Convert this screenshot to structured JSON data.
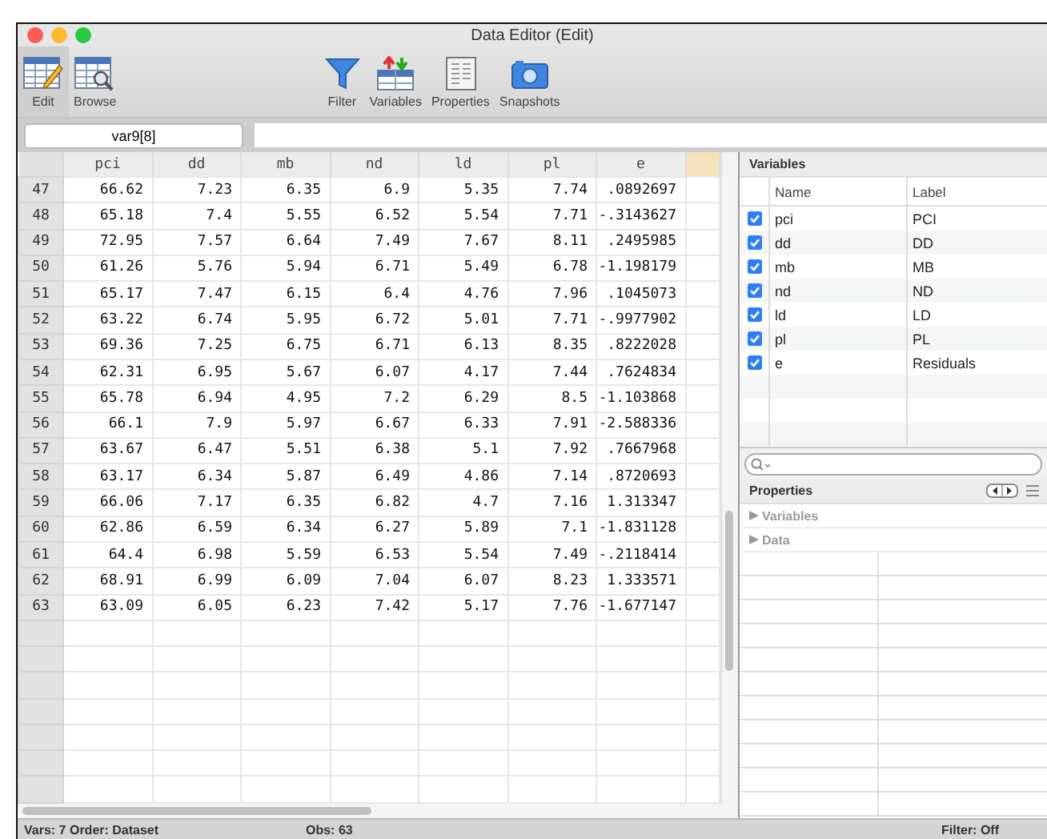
{
  "window": {
    "title": "Data Editor (Edit)"
  },
  "toolbar": {
    "modes": [
      {
        "label": "Edit",
        "kind": "edit",
        "selected": true
      },
      {
        "label": "Browse",
        "kind": "browse",
        "selected": false
      }
    ],
    "tools": [
      {
        "label": "Filter",
        "kind": "filter"
      },
      {
        "label": "Variables",
        "kind": "variables"
      },
      {
        "label": "Properties",
        "kind": "properties"
      },
      {
        "label": "Snapshots",
        "kind": "snapshots"
      }
    ]
  },
  "cell_reference": "var9[8]",
  "table": {
    "columns": [
      "pci",
      "dd",
      "mb",
      "nd",
      "ld",
      "pl",
      "e"
    ],
    "rows": [
      {
        "number": "47",
        "cells": [
          "66.62",
          "7.23",
          "6.35",
          "6.9",
          "5.35",
          "7.74",
          ".0892697"
        ]
      },
      {
        "number": "48",
        "cells": [
          "65.18",
          "7.4",
          "5.55",
          "6.52",
          "5.54",
          "7.71",
          "-.3143627"
        ]
      },
      {
        "number": "49",
        "cells": [
          "72.95",
          "7.57",
          "6.64",
          "7.49",
          "7.67",
          "8.11",
          ".2495985"
        ]
      },
      {
        "number": "50",
        "cells": [
          "61.26",
          "5.76",
          "5.94",
          "6.71",
          "5.49",
          "6.78",
          "-1.198179"
        ]
      },
      {
        "number": "51",
        "cells": [
          "65.17",
          "7.47",
          "6.15",
          "6.4",
          "4.76",
          "7.96",
          ".1045073"
        ]
      },
      {
        "number": "52",
        "cells": [
          "63.22",
          "6.74",
          "5.95",
          "6.72",
          "5.01",
          "7.71",
          "-.9977902"
        ]
      },
      {
        "number": "53",
        "cells": [
          "69.36",
          "7.25",
          "6.75",
          "6.71",
          "6.13",
          "8.35",
          ".8222028"
        ]
      },
      {
        "number": "54",
        "cells": [
          "62.31",
          "6.95",
          "5.67",
          "6.07",
          "4.17",
          "7.44",
          ".7624834"
        ]
      },
      {
        "number": "55",
        "cells": [
          "65.78",
          "6.94",
          "4.95",
          "7.2",
          "6.29",
          "8.5",
          "-1.103868"
        ]
      },
      {
        "number": "56",
        "cells": [
          "66.1",
          "7.9",
          "5.97",
          "6.67",
          "6.33",
          "7.91",
          "-2.588336"
        ]
      },
      {
        "number": "57",
        "cells": [
          "63.67",
          "6.47",
          "5.51",
          "6.38",
          "5.1",
          "7.92",
          ".7667968"
        ]
      },
      {
        "number": "58",
        "cells": [
          "63.17",
          "6.34",
          "5.87",
          "6.49",
          "4.86",
          "7.14",
          ".8720693"
        ]
      },
      {
        "number": "59",
        "cells": [
          "66.06",
          "7.17",
          "6.35",
          "6.82",
          "4.7",
          "7.16",
          "1.313347"
        ]
      },
      {
        "number": "60",
        "cells": [
          "62.86",
          "6.59",
          "6.34",
          "6.27",
          "5.89",
          "7.1",
          "-1.831128"
        ]
      },
      {
        "number": "61",
        "cells": [
          "64.4",
          "6.98",
          "5.59",
          "6.53",
          "5.54",
          "7.49",
          "-.2118414"
        ]
      },
      {
        "number": "62",
        "cells": [
          "68.91",
          "6.99",
          "6.09",
          "7.04",
          "6.07",
          "8.23",
          "1.333571"
        ]
      },
      {
        "number": "63",
        "cells": [
          "63.09",
          "6.05",
          "6.23",
          "7.42",
          "5.17",
          "7.76",
          "-1.677147"
        ]
      }
    ]
  },
  "variables_panel": {
    "title": "Variables",
    "columns": [
      "Name",
      "Label"
    ],
    "rows": [
      {
        "name": "pci",
        "label": "PCI",
        "checked": true
      },
      {
        "name": "dd",
        "label": "DD",
        "checked": true
      },
      {
        "name": "mb",
        "label": "MB",
        "checked": true
      },
      {
        "name": "nd",
        "label": "ND",
        "checked": true
      },
      {
        "name": "ld",
        "label": "LD",
        "checked": true
      },
      {
        "name": "pl",
        "label": "PL",
        "checked": true
      },
      {
        "name": "e",
        "label": "Residuals",
        "checked": true
      }
    ]
  },
  "properties_panel": {
    "title": "Properties",
    "sections": [
      {
        "label": "Variables",
        "expanded": false
      },
      {
        "label": "Data",
        "expanded": false
      }
    ]
  },
  "status_bar": [
    "Vars: 7  Order: Dataset",
    "Obs: 63",
    "Filter: Off"
  ]
}
